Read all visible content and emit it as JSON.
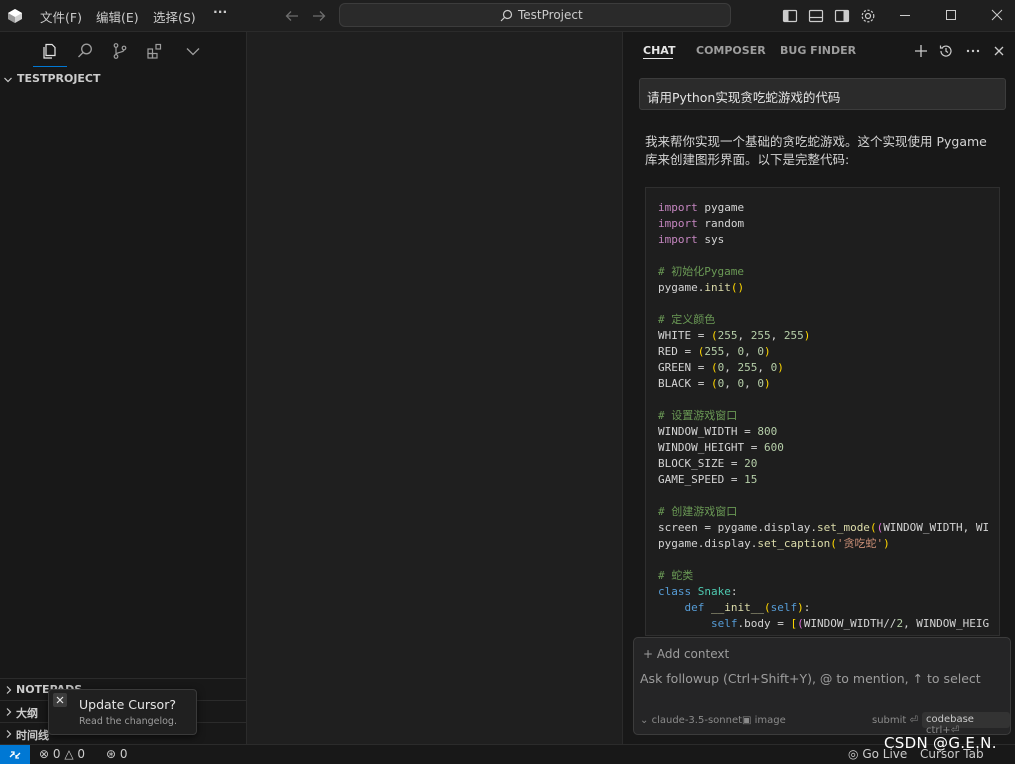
{
  "titlebar": {
    "menus": [
      "文件(F)",
      "编辑(E)",
      "选择(S)",
      "···"
    ],
    "search_text": "TestProject"
  },
  "sidebar": {
    "explorer_title": "TESTPROJECT",
    "sections": [
      "NOTEPADS",
      "大纲",
      "时间线"
    ]
  },
  "chat": {
    "tabs": [
      "CHAT",
      "COMPOSER",
      "BUG FINDER"
    ],
    "active_tab": "CHAT",
    "user_message": "请用Python实现贪吃蛇游戏的代码",
    "ai_intro": "我来帮你实现一个基础的贪吃蛇游戏。这个实现使用 Pygame 库来创建图形界面。以下是完整代码:",
    "add_context": "Add context",
    "followup_placeholder": "Ask followup (Ctrl+Shift+Y), @ to mention, ↑ to select",
    "model": "claude-3.5-sonnet",
    "image_label": "image",
    "submit_label": "submit",
    "codebase_label": "codebase",
    "codebase_shortcut": "ctrl+⏎"
  },
  "statusbar": {
    "errors": "0",
    "warnings": "0",
    "ports": "0",
    "go_live": "Go Live",
    "cursor_tab": "Cursor Tab"
  },
  "toast": {
    "title": "Update Cursor?",
    "subtitle": "Read the changelog."
  },
  "watermark": "CSDN @G.E.N.",
  "colors": {
    "accent": "#0078d4",
    "background": "#1f1f1f",
    "panel": "#181818"
  }
}
